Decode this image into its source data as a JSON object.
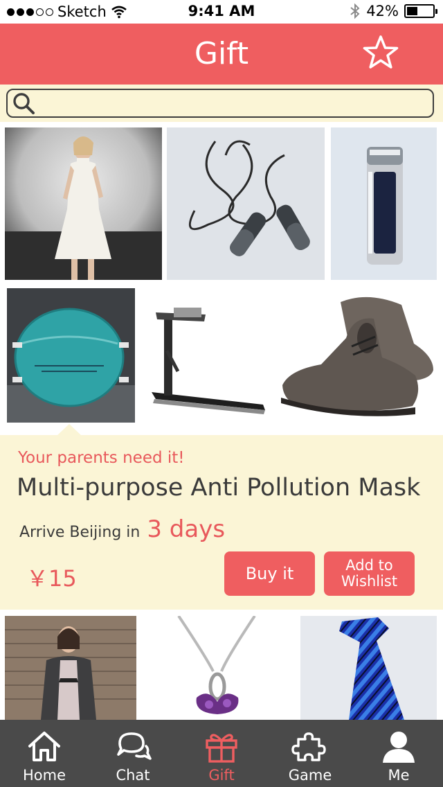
{
  "status_bar": {
    "carrier": "Sketch",
    "time": "9:41 AM",
    "battery": "42%",
    "battery_level": 0.42
  },
  "header": {
    "title": "Gift",
    "favorite_icon": "star-icon"
  },
  "search": {
    "placeholder": "",
    "value": "",
    "icon": "search-icon"
  },
  "products_top": [
    {
      "name": "white-dress",
      "icon": "dress-photo"
    },
    {
      "name": "jump-rope",
      "icon": "jump-rope-photo"
    },
    {
      "name": "thermos",
      "icon": "thermos-photo"
    },
    {
      "name": "mask",
      "icon": "mask-photo"
    },
    {
      "name": "treadmill",
      "icon": "treadmill-photo"
    },
    {
      "name": "leather-boots",
      "icon": "boots-photo"
    }
  ],
  "detail": {
    "tagline": "Your parents need it!",
    "title": "Multi-purpose Anti Pollution Mask",
    "arrive_prefix": "Arrive Beijing in",
    "arrive_days": "3 days",
    "price": "￥15",
    "buy_label": "Buy it",
    "wishlist_line1": "Add to",
    "wishlist_line2": "Wishlist"
  },
  "products_bottom": [
    {
      "name": "patterned-dress-coat",
      "icon": "coat-photo"
    },
    {
      "name": "crystal-pendant",
      "icon": "pendant-photo"
    },
    {
      "name": "striped-tie",
      "icon": "tie-photo"
    }
  ],
  "tabs": [
    {
      "label": "Home",
      "icon": "home-icon"
    },
    {
      "label": "Chat",
      "icon": "chat-icon"
    },
    {
      "label": "Gift",
      "icon": "gift-icon",
      "active": true
    },
    {
      "label": "Game",
      "icon": "puzzle-icon"
    },
    {
      "label": "Me",
      "icon": "person-icon"
    }
  ],
  "colors": {
    "accent": "#ef5e60",
    "cream": "#fbf5d6",
    "tabbar": "#4a4a4a"
  }
}
